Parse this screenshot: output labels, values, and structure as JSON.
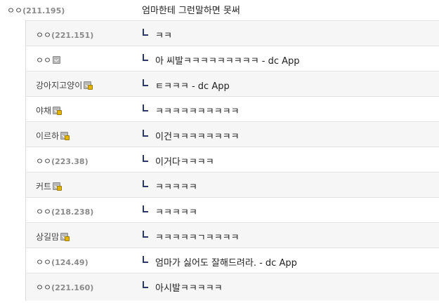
{
  "parent": {
    "nick": "ㅇㅇ",
    "ip": "(211.195)",
    "memo": "엄마한테 그런말하면 못써"
  },
  "replies": [
    {
      "nick": "ㅇㅇ",
      "ip": "(221.151)",
      "badge": null,
      "memo": "ㅋㅋ"
    },
    {
      "nick": "ㅇㅇ",
      "ip": "",
      "badge": "fixed-nick-icon",
      "memo": "아 씨발ㅋㅋㅋㅋㅋㅋㅋㅋㅋ - dc App"
    },
    {
      "nick": "강아지고양이",
      "ip": "",
      "badge": "gallog-lock-icon",
      "memo": "ㅌㅋㅋㅋ - dc App"
    },
    {
      "nick": "야채",
      "ip": "",
      "badge": "gallog-lock-icon",
      "memo": "ㅋㅋㅋㅋㅋㅋㅋㅋㅋㅋ"
    },
    {
      "nick": "이르하",
      "ip": "",
      "badge": "gallog-lock-icon",
      "memo": "이건ㅋㅋㅋㅋㅋㅋㅋㅋ"
    },
    {
      "nick": "ㅇㅇ",
      "ip": "(223.38)",
      "badge": null,
      "memo": "이거다ㅋㅋㅋㅋ"
    },
    {
      "nick": "커트",
      "ip": "",
      "badge": "gallog-lock-icon",
      "memo": "ㅋㅋㅋㅋㅋ"
    },
    {
      "nick": "ㅇㅇ",
      "ip": "(218.238)",
      "badge": null,
      "memo": "ㅋㅋㅋㅋㅋ"
    },
    {
      "nick": "상길맘",
      "ip": "",
      "badge": "gallog-lock-icon",
      "memo": "ㅋㅋㅋㅋㅋㄱㅋㅋㅋㅋ"
    },
    {
      "nick": "ㅇㅇ",
      "ip": "(124.49)",
      "badge": null,
      "memo": "엄마가 싫어도 잘해드려라. - dc App"
    },
    {
      "nick": "ㅇㅇ",
      "ip": "(221.160)",
      "badge": null,
      "memo": "아시발ㅋㅋㅋㅋㅋ"
    }
  ],
  "colors": {
    "ip": "#8a8a8a",
    "arrow": "#2a3a66",
    "row_alt": "#f6f6f6",
    "divider": "#e3e3e3"
  }
}
